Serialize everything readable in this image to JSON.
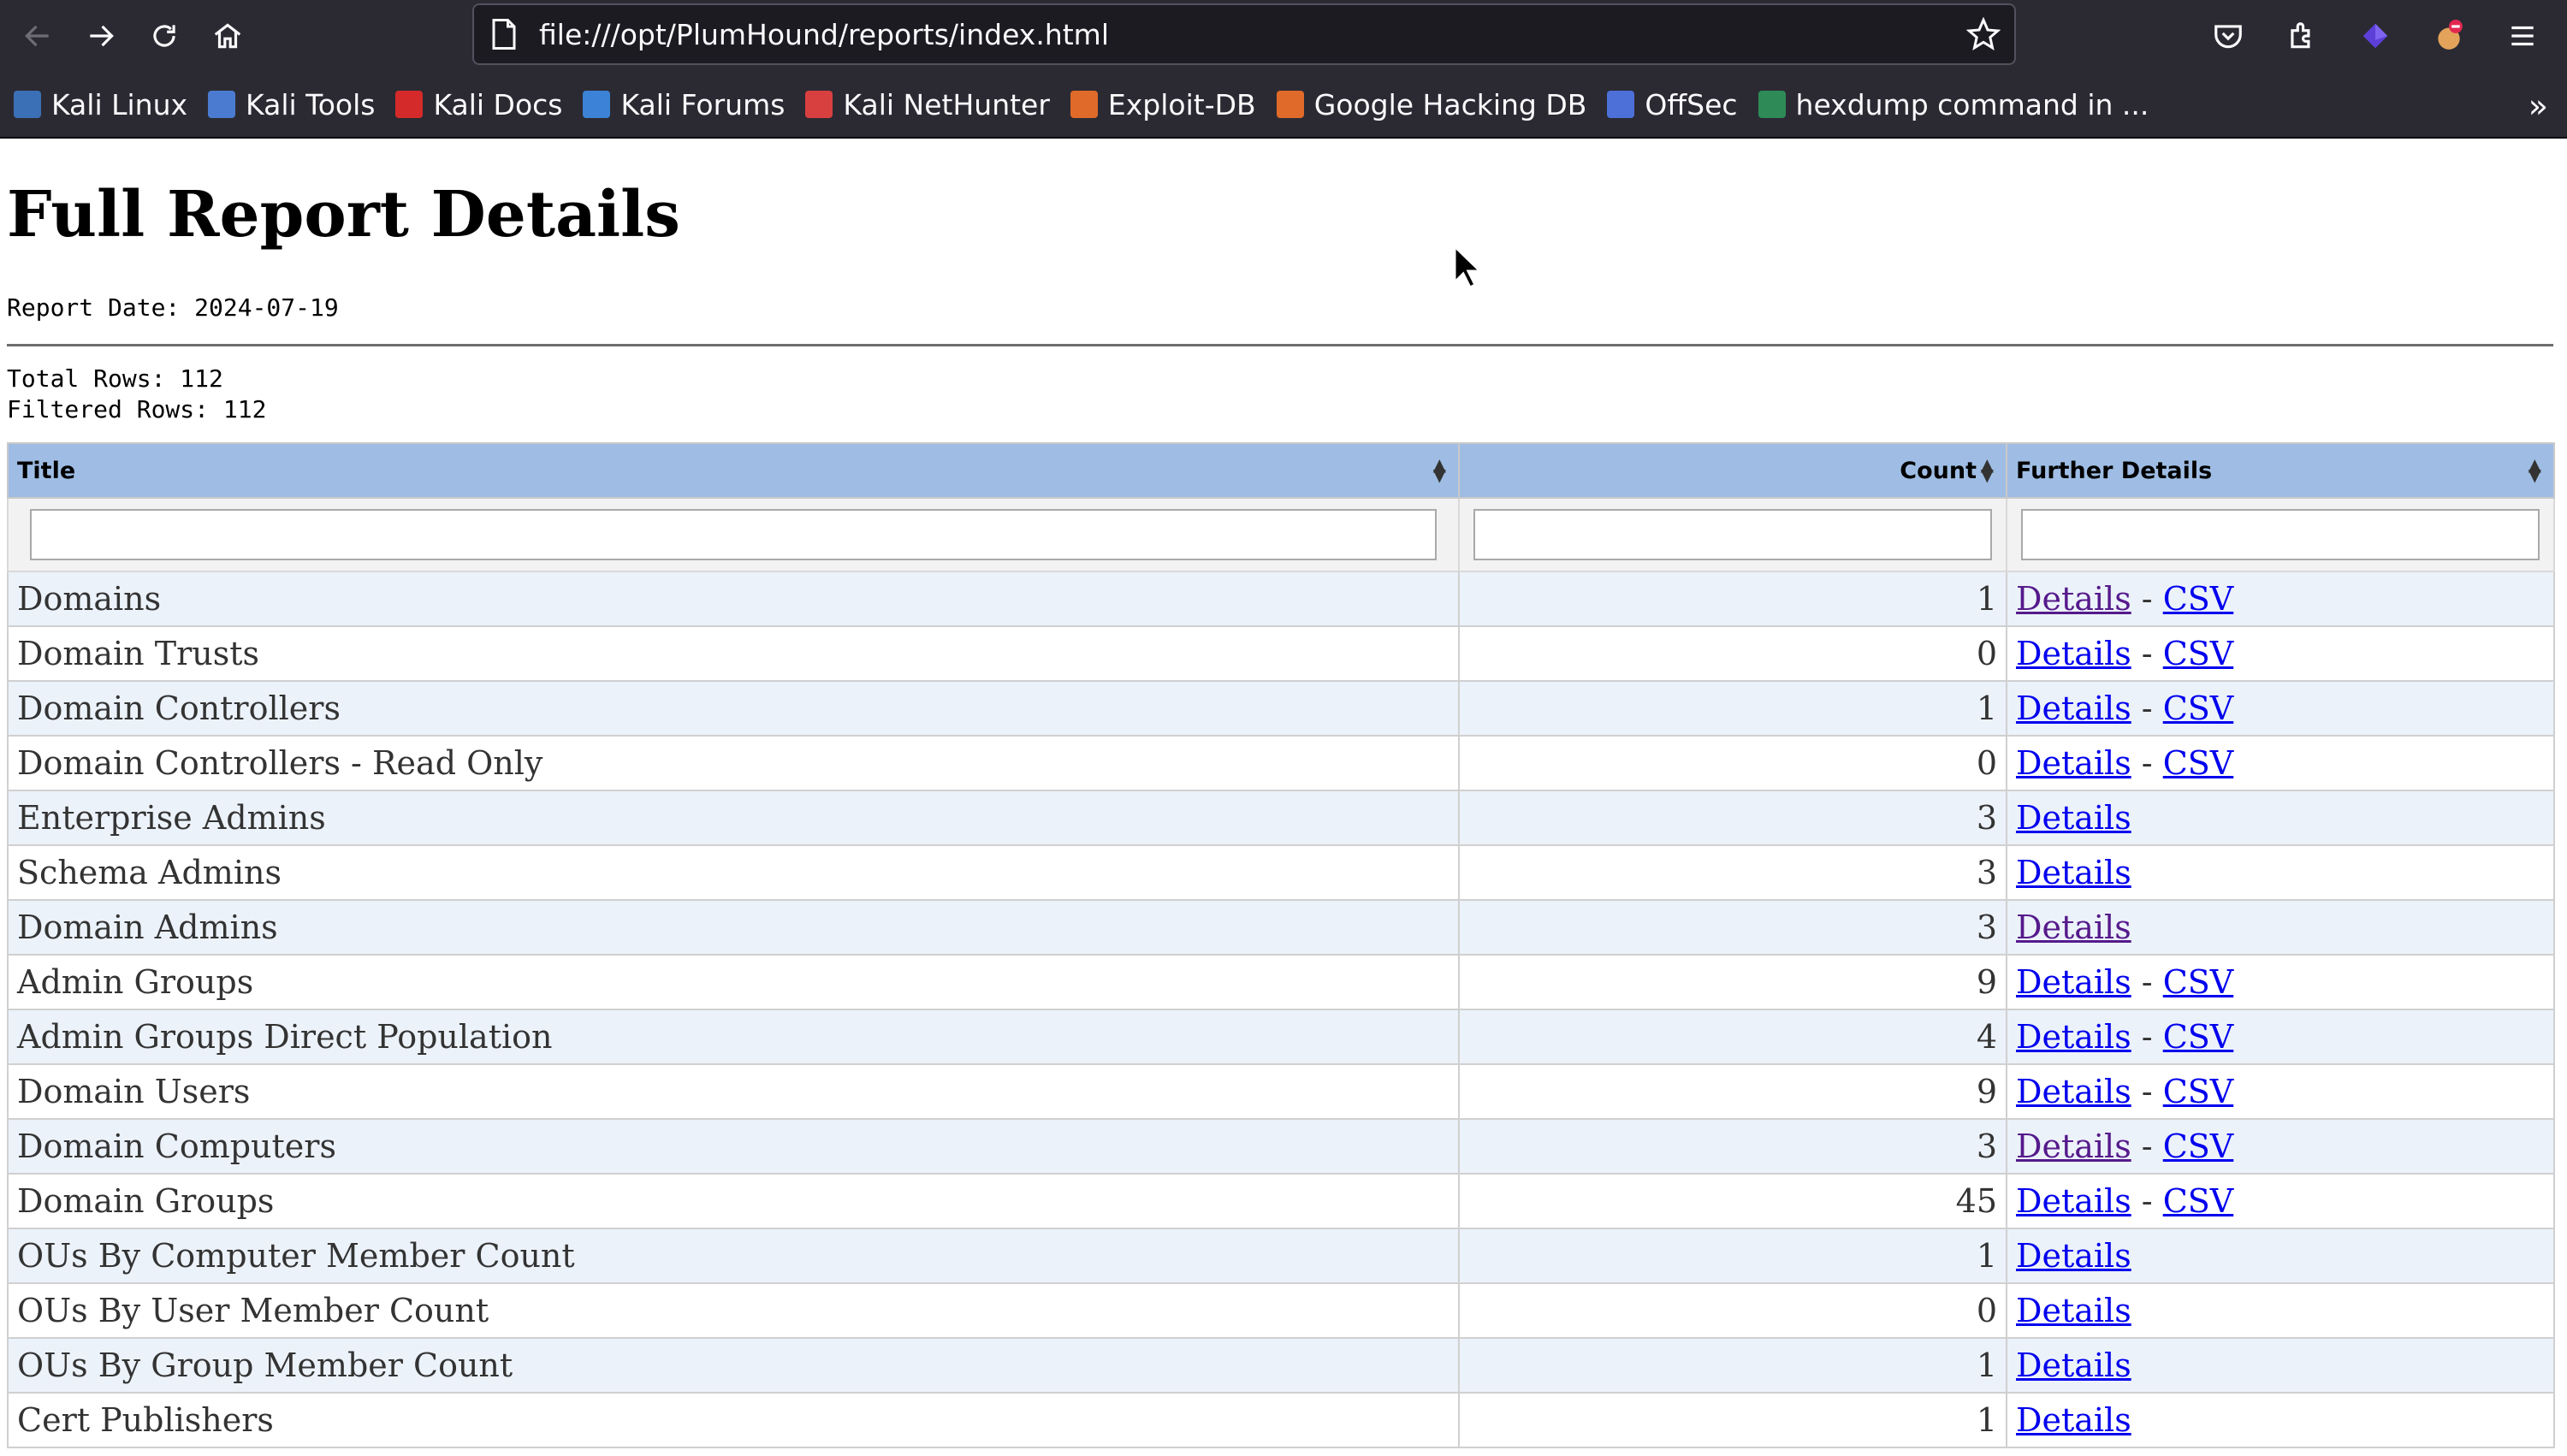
{
  "browser": {
    "url": "file:///opt/PlumHound/reports/index.html",
    "bookmarks": [
      {
        "label": "Kali Linux",
        "color": "#3b6fb6"
      },
      {
        "label": "Kali Tools",
        "color": "#4a7bd0"
      },
      {
        "label": "Kali Docs",
        "color": "#d52a2a"
      },
      {
        "label": "Kali Forums",
        "color": "#3c82d6"
      },
      {
        "label": "Kali NetHunter",
        "color": "#d84040"
      },
      {
        "label": "Exploit-DB",
        "color": "#e06a2a"
      },
      {
        "label": "Google Hacking DB",
        "color": "#e06a2a"
      },
      {
        "label": "OffSec",
        "color": "#4d6fd8"
      },
      {
        "label": "hexdump command in ...",
        "color": "#2e8b57"
      }
    ]
  },
  "page": {
    "title": "Full Report Details",
    "report_date": "Report Date: 2024-07-19",
    "total_rows": "Total Rows: 112",
    "filtered_rows": "Filtered Rows: 112"
  },
  "table": {
    "columns": [
      "Title",
      "Count",
      "Further Details"
    ],
    "details_label": "Details",
    "csv_label": "CSV",
    "separator": " - ",
    "rows": [
      {
        "title": "Domains",
        "count": "1",
        "csv": true,
        "visited": true
      },
      {
        "title": "Domain Trusts",
        "count": "0",
        "csv": true,
        "visited": false
      },
      {
        "title": "Domain Controllers",
        "count": "1",
        "csv": true,
        "visited": false
      },
      {
        "title": "Domain Controllers - Read Only",
        "count": "0",
        "csv": true,
        "visited": false
      },
      {
        "title": "Enterprise Admins",
        "count": "3",
        "csv": false,
        "visited": false
      },
      {
        "title": "Schema Admins",
        "count": "3",
        "csv": false,
        "visited": false
      },
      {
        "title": "Domain Admins",
        "count": "3",
        "csv": false,
        "visited": true
      },
      {
        "title": "Admin Groups",
        "count": "9",
        "csv": true,
        "visited": false
      },
      {
        "title": "Admin Groups Direct Population",
        "count": "4",
        "csv": true,
        "visited": false
      },
      {
        "title": "Domain Users",
        "count": "9",
        "csv": true,
        "visited": false
      },
      {
        "title": "Domain Computers",
        "count": "3",
        "csv": true,
        "visited": true
      },
      {
        "title": "Domain Groups",
        "count": "45",
        "csv": true,
        "visited": false
      },
      {
        "title": "OUs By Computer Member Count",
        "count": "1",
        "csv": false,
        "visited": false
      },
      {
        "title": "OUs By User Member Count",
        "count": "0",
        "csv": false,
        "visited": false
      },
      {
        "title": "OUs By Group Member Count",
        "count": "1",
        "csv": false,
        "visited": false
      },
      {
        "title": "Cert Publishers",
        "count": "1",
        "csv": false,
        "visited": false
      }
    ]
  }
}
